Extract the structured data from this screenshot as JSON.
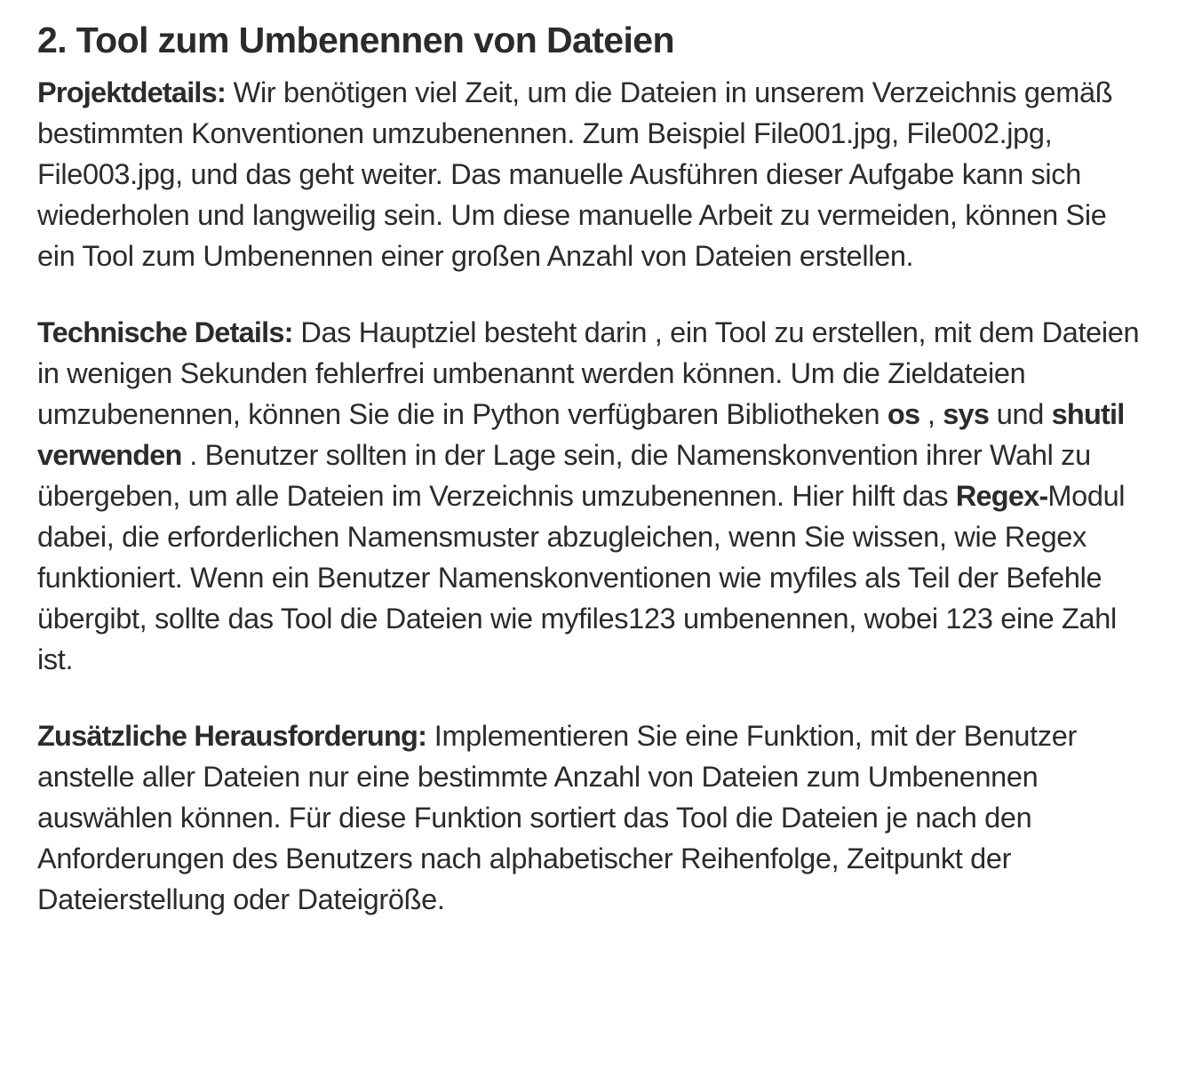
{
  "title": "2. Tool zum Umbenennen von Dateien",
  "sections": [
    {
      "label": "Projektdetails:",
      "text": " Wir benötigen viel Zeit, um die Dateien in unserem Verzeichnis gemäß bestimmten Konventionen umzubenennen. Zum Beispiel File001.jpg, File002.jpg, File003.jpg, und das geht weiter. Das manuelle Ausführen dieser Aufgabe kann sich wiederholen und langweilig sein. Um diese manuelle Arbeit zu vermeiden, können Sie ein Tool zum Umbenennen einer großen Anzahl von Dateien erstellen."
    },
    {
      "label": "Technische Details:",
      "text_1": " Das Hauptziel besteht darin , ein Tool zu erstellen, mit dem Dateien in wenigen Sekunden fehlerfrei umbenannt werden können. Um die Zieldateien umzubenennen, können Sie die   in Python verfügbaren Bibliotheken ",
      "lib_os": "os",
      "sep_1": " , ",
      "lib_sys": "sys",
      "sep_2": " und ",
      "lib_shutil": "shutil verwenden",
      "text_2": " . Benutzer sollten in der Lage sein, die Namenskonvention ihrer Wahl zu übergeben, um alle Dateien im Verzeichnis umzubenennen. Hier hilft das ",
      "regex": "Regex-",
      "text_3": "Modul dabei, die erforderlichen Namensmuster abzugleichen, wenn Sie wissen, wie Regex funktioniert. Wenn ein Benutzer Namenskonventionen wie myfiles als Teil der Befehle übergibt, sollte das Tool die Dateien wie myfiles123 umbenennen, wobei 123 eine Zahl ist."
    },
    {
      "label": "Zusätzliche Herausforderung:",
      "text": " Implementieren Sie eine Funktion, mit der Benutzer anstelle aller Dateien nur eine bestimmte Anzahl von Dateien zum Umbenennen auswählen können. Für diese Funktion sortiert das Tool die Dateien je nach den Anforderungen des Benutzers nach alphabetischer Reihenfolge, Zeitpunkt der Dateierstellung oder Dateigröße."
    }
  ]
}
